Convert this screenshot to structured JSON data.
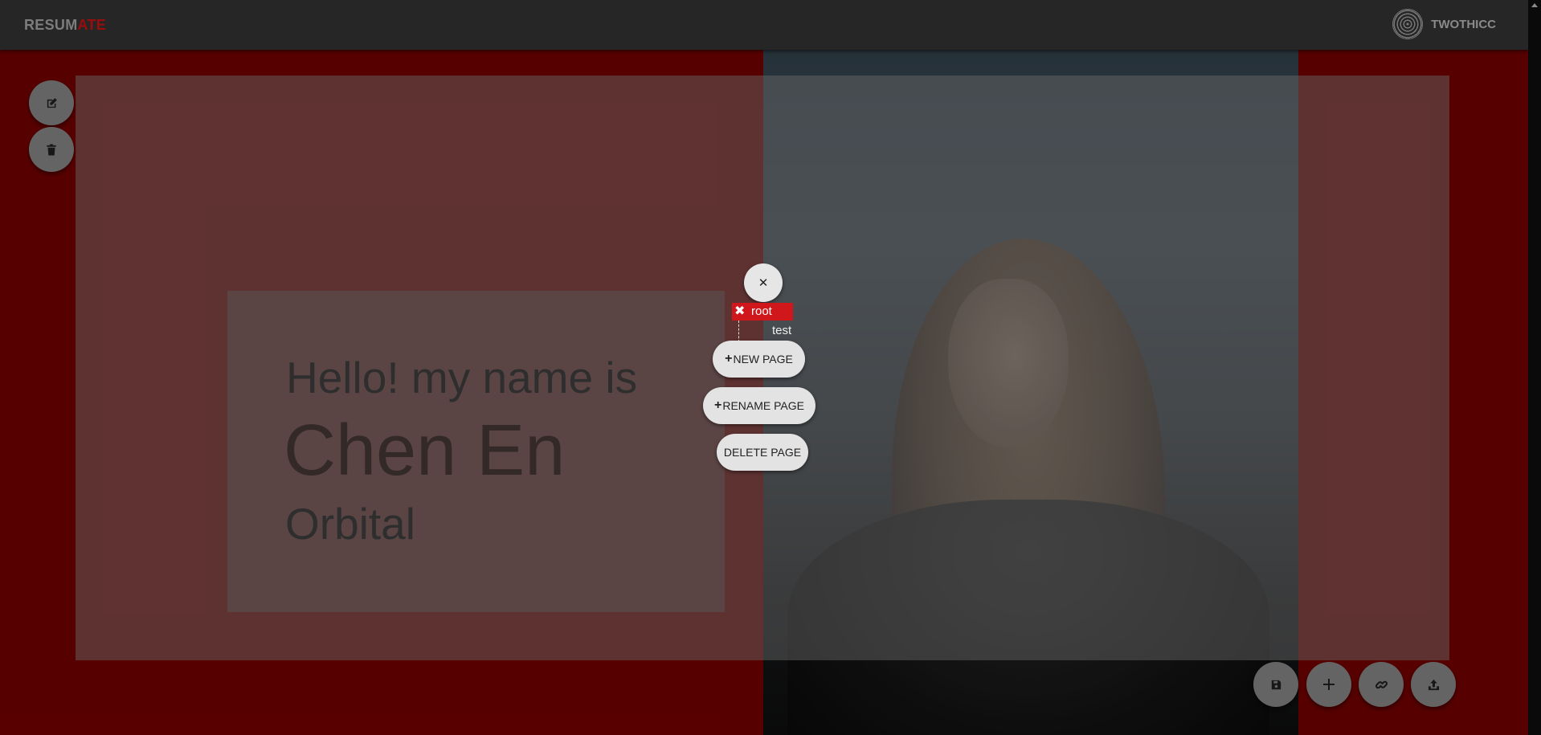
{
  "app": {
    "brand_part1": "RESUM",
    "brand_part2": "ATE",
    "username": "TWOTHICC"
  },
  "colors": {
    "background": "#6b0000",
    "topbar": "#262626",
    "brand_accent": "#9b0c0c",
    "root_node": "#d0171b",
    "pill": "#e3e3e3"
  },
  "left_toolbar": {
    "edit_icon": "edit-icon",
    "delete_icon": "trash-icon"
  },
  "canvas": {
    "greeting": "Hello! my name is",
    "name": "Chen En",
    "subtitle": "Orbital"
  },
  "page_menu": {
    "close_icon": "✕",
    "root_remove_icon": "✖",
    "root_label": "root",
    "child_label": "test",
    "plus": "+",
    "new_page": "NEW PAGE",
    "rename_page": "RENAME PAGE",
    "delete_page": "DELETE PAGE"
  },
  "bottom_toolbar": {
    "save_icon": "save-icon",
    "add_icon": "plus-icon",
    "link_icon": "link-icon",
    "upload_icon": "upload-icon"
  }
}
